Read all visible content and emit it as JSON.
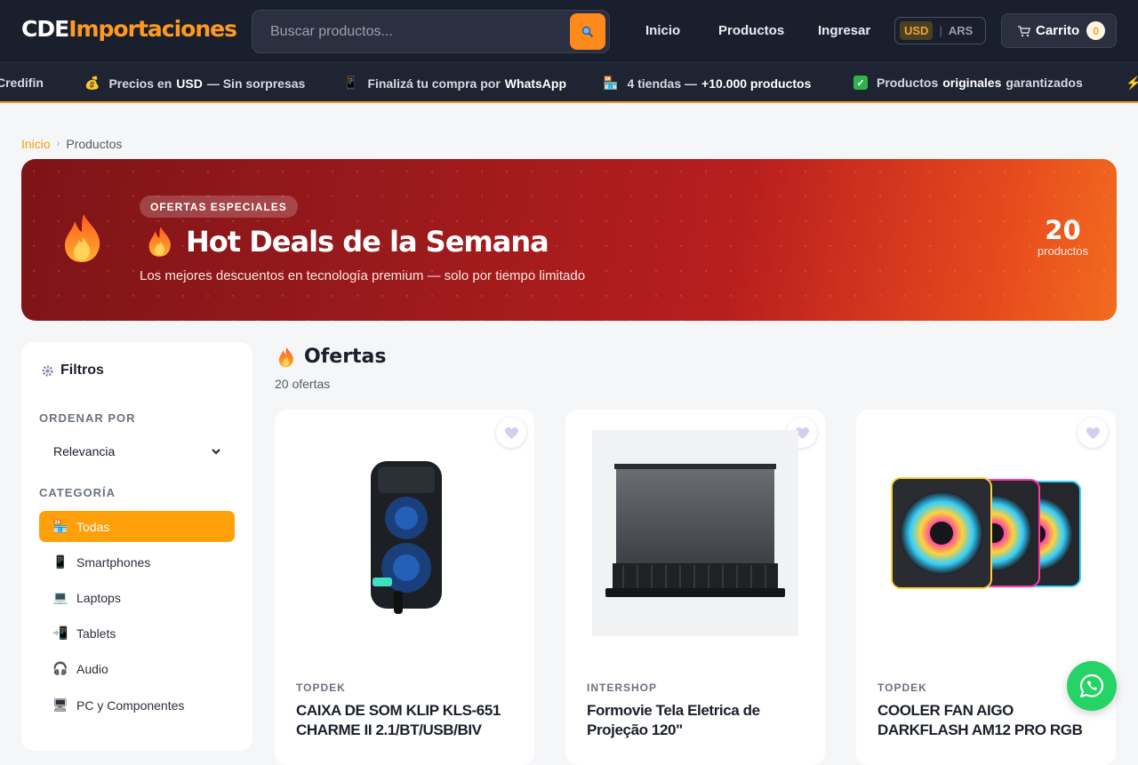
{
  "header": {
    "logo_part1": "CDE",
    "logo_part2": "Importaciones",
    "search_placeholder": "Buscar productos...",
    "nav": [
      "Inicio",
      "Productos",
      "Ingresar"
    ],
    "currency": {
      "selected": "USD",
      "other": "ARS"
    },
    "cart_label": "Carrito",
    "cart_count": "0"
  },
  "ticker": [
    {
      "icon": "card-icon",
      "pre": "Credifin",
      "bold": "",
      "post": ""
    },
    {
      "icon": "money-bag-icon",
      "pre": "Precios en",
      "bold": "USD",
      "post": "— Sin sorpresas"
    },
    {
      "icon": "phone-icon",
      "pre": "Finalizá tu compra por",
      "bold": "WhatsApp",
      "post": ""
    },
    {
      "icon": "store-icon",
      "pre": "4 tiendas —",
      "bold": "+10.000 productos",
      "post": ""
    },
    {
      "icon": "check-icon",
      "pre": "Productos",
      "bold": "originales",
      "post": "garantizados"
    }
  ],
  "breadcrumb": {
    "home": "Inicio",
    "current": "Productos"
  },
  "hero": {
    "badge": "OFERTAS ESPECIALES",
    "title": "Hot Deals de la Semana",
    "subtitle": "Los mejores descuentos en tecnología premium — solo por tiempo limitado",
    "count": "20",
    "count_label": "productos"
  },
  "sidebar": {
    "title": "Filtros",
    "sort_label": "ORDENAR POR",
    "sort_value": "Relevancia",
    "category_label": "CATEGORÍA",
    "categories": [
      {
        "label": "Todas",
        "icon": "store-icon",
        "active": true
      },
      {
        "label": "Smartphones",
        "icon": "phone-icon",
        "active": false
      },
      {
        "label": "Laptops",
        "icon": "laptop-icon",
        "active": false
      },
      {
        "label": "Tablets",
        "icon": "tablet-icon",
        "active": false
      },
      {
        "label": "Audio",
        "icon": "headphones-icon",
        "active": false
      },
      {
        "label": "PC y Componentes",
        "icon": "desktop-icon",
        "active": false
      }
    ]
  },
  "main": {
    "title": "Ofertas",
    "count_text": "20 ofertas",
    "products": [
      {
        "brand": "TOPDEK",
        "name": "CAIXA DE SOM KLIP KLS-651 CHARME II 2.1/BT/USB/BIV"
      },
      {
        "brand": "INTERSHOP",
        "name": "Formovie Tela Eletrica de Projeção 120\""
      },
      {
        "brand": "TOPDEK",
        "name": "COOLER FAN AIGO DARKFLASH AM12 PRO RGB"
      }
    ]
  },
  "colors": {
    "accent": "#ff9f0a",
    "header_bg": "#1a1f2e",
    "hero_start": "#7d1417",
    "hero_end": "#f26c1e",
    "whatsapp": "#25d366"
  }
}
